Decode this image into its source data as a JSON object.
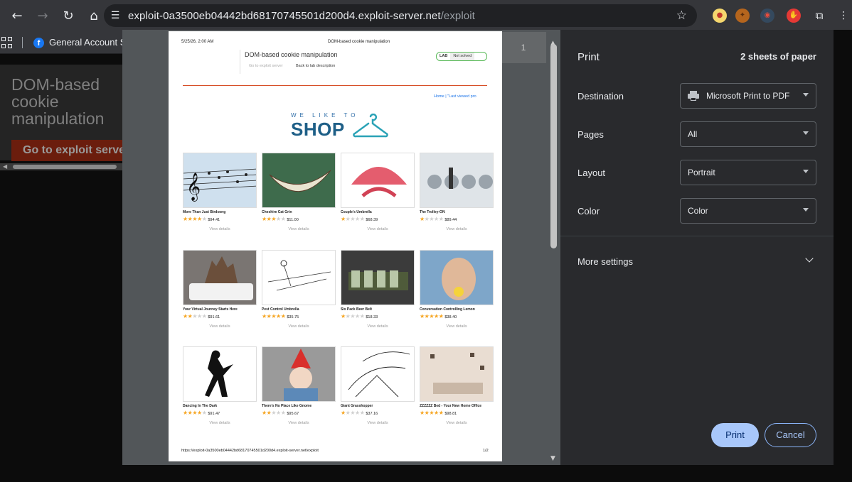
{
  "browser": {
    "url_host": "exploit-0a3500eb04442bd68170745501d200d4.exploit-server.net",
    "url_path": "/exploit",
    "bookmark_label": "General Account Se"
  },
  "page": {
    "title": "DOM-based cookie manipulation",
    "button_label": "Go to exploit server"
  },
  "preview": {
    "page_number": "1",
    "header_date": "5/25/26, 2:00 AM",
    "header_title": "DOM-based cookie manipulation",
    "lab_title": "DOM-based cookie manipulation",
    "lab_link_exploit": "Go to exploit server",
    "lab_link_desc": "Back to lab description",
    "lab_badge": "LAB",
    "lab_status": "Not solved",
    "nav_links": "Home  |  \"Last viewed pro",
    "shop_small": "WE LIKE TO",
    "shop_big": "SHOP",
    "view_details": "View details",
    "footer_url": "https://exploit-0a3500eb04442bd68170745501d200d4.exploit-server.net/exploit",
    "footer_page": "1/2",
    "products": [
      {
        "name": "More Than Just Birdsong",
        "rating": 4,
        "price": "$94.41"
      },
      {
        "name": "Cheshire Cat Grin",
        "rating": 3,
        "price": "$11.00"
      },
      {
        "name": "Couple's Umbrella",
        "rating": 1,
        "price": "$68.39"
      },
      {
        "name": "The Trolley-ON",
        "rating": 1,
        "price": "$89.44"
      },
      {
        "name": "Your Virtual Journey Starts Here",
        "rating": 2,
        "price": "$91.61"
      },
      {
        "name": "Pest Control Umbrella",
        "rating": 5,
        "price": "$35.75"
      },
      {
        "name": "Six Pack Beer Belt",
        "rating": 1,
        "price": "$18.33"
      },
      {
        "name": "Conversation Controlling Lemon",
        "rating": 5,
        "price": "$38.40"
      },
      {
        "name": "Dancing In The Dark",
        "rating": 4,
        "price": "$91.47"
      },
      {
        "name": "There's No Place Like Gnome",
        "rating": 2,
        "price": "$95.67"
      },
      {
        "name": "Giant Grasshopper",
        "rating": 1,
        "price": "$37.16"
      },
      {
        "name": "ZZZZZZ Bed - Your New Home Office",
        "rating": 5,
        "price": "$98.81"
      }
    ]
  },
  "settings": {
    "title": "Print",
    "sheets": "2 sheets of paper",
    "destination_label": "Destination",
    "destination_value": "Microsoft Print to PDF",
    "pages_label": "Pages",
    "pages_value": "All",
    "layout_label": "Layout",
    "layout_value": "Portrait",
    "color_label": "Color",
    "color_value": "Color",
    "more_settings": "More settings",
    "print_label": "Print",
    "cancel_label": "Cancel"
  },
  "colors": {
    "accent": "#a8c7fa",
    "panel": "#292a2d",
    "preview_bg": "#525659",
    "star_on": "#f6a623",
    "lab_red": "#d74e26"
  }
}
